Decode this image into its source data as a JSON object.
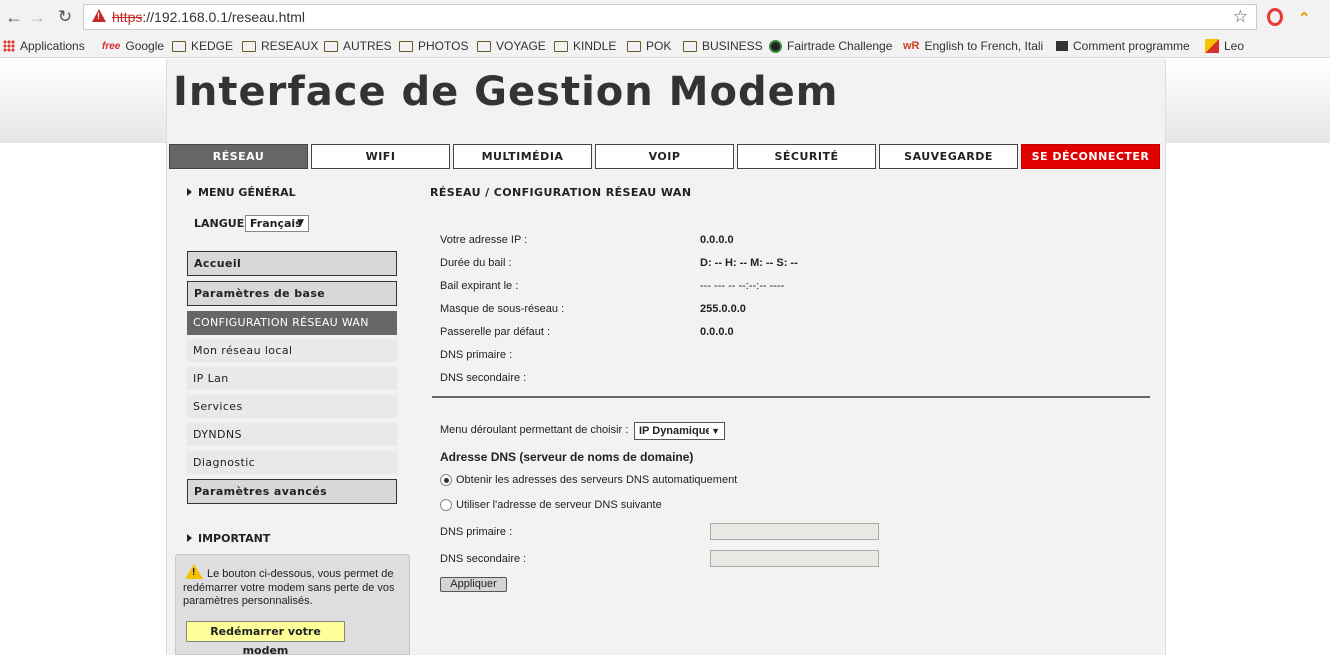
{
  "browser": {
    "url_scheme": "https",
    "url_rest": "://192.168.0.1/reseau.html",
    "bookmarks": [
      {
        "label": "Applications",
        "icon": "apps-grid-icon"
      },
      {
        "label": "Google",
        "icon": "free-logo-icon"
      },
      {
        "label": "KEDGE",
        "icon": "folder-icon"
      },
      {
        "label": "RESEAUX",
        "icon": "folder-icon"
      },
      {
        "label": "AUTRES",
        "icon": "folder-icon"
      },
      {
        "label": "PHOTOS",
        "icon": "folder-icon"
      },
      {
        "label": "VOYAGE",
        "icon": "folder-icon"
      },
      {
        "label": "KINDLE",
        "icon": "folder-icon"
      },
      {
        "label": "POK",
        "icon": "folder-icon"
      },
      {
        "label": "BUSINESS",
        "icon": "folder-icon"
      },
      {
        "label": "Fairtrade Challenge",
        "icon": "fairtrade-icon"
      },
      {
        "label": "English to French, Itali",
        "icon": "wordreference-icon"
      },
      {
        "label": "Comment programme",
        "icon": "page-icon"
      },
      {
        "label": "Leo",
        "icon": "leo-icon"
      }
    ],
    "free_logo_text": "free",
    "wr_logo_text": "wR"
  },
  "site": {
    "title": "Interface de Gestion Modem"
  },
  "tabs": [
    {
      "label": "RÉSEAU",
      "active": true
    },
    {
      "label": "WIFI"
    },
    {
      "label": "MULTIMÉDIA"
    },
    {
      "label": "VOIP"
    },
    {
      "label": "SÉCURITÉ"
    },
    {
      "label": "SAUVEGARDE"
    },
    {
      "label": "SE DÉCONNECTER"
    }
  ],
  "sidebar": {
    "general_heading": "MENU GÉNÉRAL",
    "language_label": "LANGUE",
    "language_value": "Français",
    "items": [
      {
        "label": "Accueil",
        "style": "box"
      },
      {
        "label": "Paramètres de base",
        "style": "box"
      },
      {
        "label": "CONFIGURATION RÉSEAU WAN",
        "style": "active"
      },
      {
        "label": "Mon réseau local",
        "style": "sub"
      },
      {
        "label": "IP Lan",
        "style": "sub"
      },
      {
        "label": "Services",
        "style": "sub"
      },
      {
        "label": "DYNDNS",
        "style": "sub"
      },
      {
        "label": "Diagnostic",
        "style": "sub"
      },
      {
        "label": "Paramètres avancés",
        "style": "box"
      }
    ],
    "important_heading": "IMPORTANT",
    "important_text": "Le bouton ci-dessous, vous permet de redémarrer votre modem sans perte de vos paramètres personnalisés.",
    "restart_button": "Redémarrer votre modem"
  },
  "main": {
    "breadcrumb_title": "RÉSEAU / CONFIGURATION RÉSEAU WAN",
    "info": [
      {
        "label": "Votre adresse IP :",
        "value": "0.0.0.0"
      },
      {
        "label": "Durée du bail :",
        "value": "D: -- H: -- M: -- S: --"
      },
      {
        "label": "Bail expirant le :",
        "value": "--- --- -- --:--:-- ----"
      },
      {
        "label": "Masque de sous-réseau :",
        "value": "255.0.0.0"
      },
      {
        "label": "Passerelle par défaut :",
        "value": "0.0.0.0"
      },
      {
        "label": "DNS primaire :",
        "value": ""
      },
      {
        "label": "DNS secondaire :",
        "value": ""
      }
    ],
    "mode_label": "Menu déroulant permettant de choisir :",
    "mode_value": "IP Dynamique",
    "dns_heading": "Adresse DNS (serveur de noms de domaine)",
    "dns_option_auto": "Obtenir les adresses des serveurs DNS automatiquement",
    "dns_option_manual": "Utiliser l'adresse de serveur DNS suivante",
    "dns_option_selected": "auto",
    "dns_primary_label": "DNS primaire :",
    "dns_secondary_label": "DNS secondaire :",
    "dns_primary_value": "",
    "dns_secondary_value": "",
    "apply_button": "Appliquer"
  }
}
